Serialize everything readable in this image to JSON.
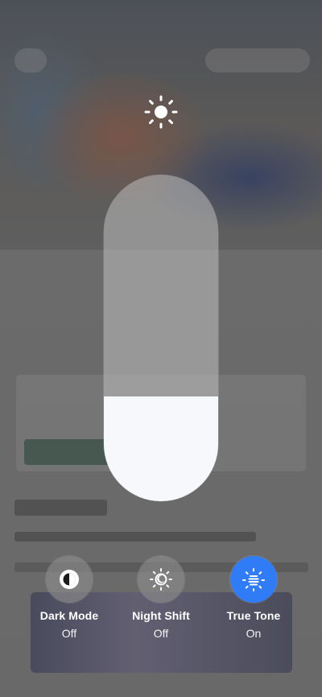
{
  "brightness": {
    "level": 0.32,
    "icon": "sun-icon"
  },
  "toggles": [
    {
      "label": "Dark Mode",
      "state": "Off",
      "icon": "dark-mode-icon",
      "on": false
    },
    {
      "label": "Night Shift",
      "state": "Off",
      "icon": "night-shift-icon",
      "on": false
    },
    {
      "label": "True Tone",
      "state": "On",
      "icon": "true-tone-icon",
      "on": true
    }
  ],
  "colors": {
    "accent": "#2f7cf6",
    "slider_fill": "#f7f8fb"
  }
}
